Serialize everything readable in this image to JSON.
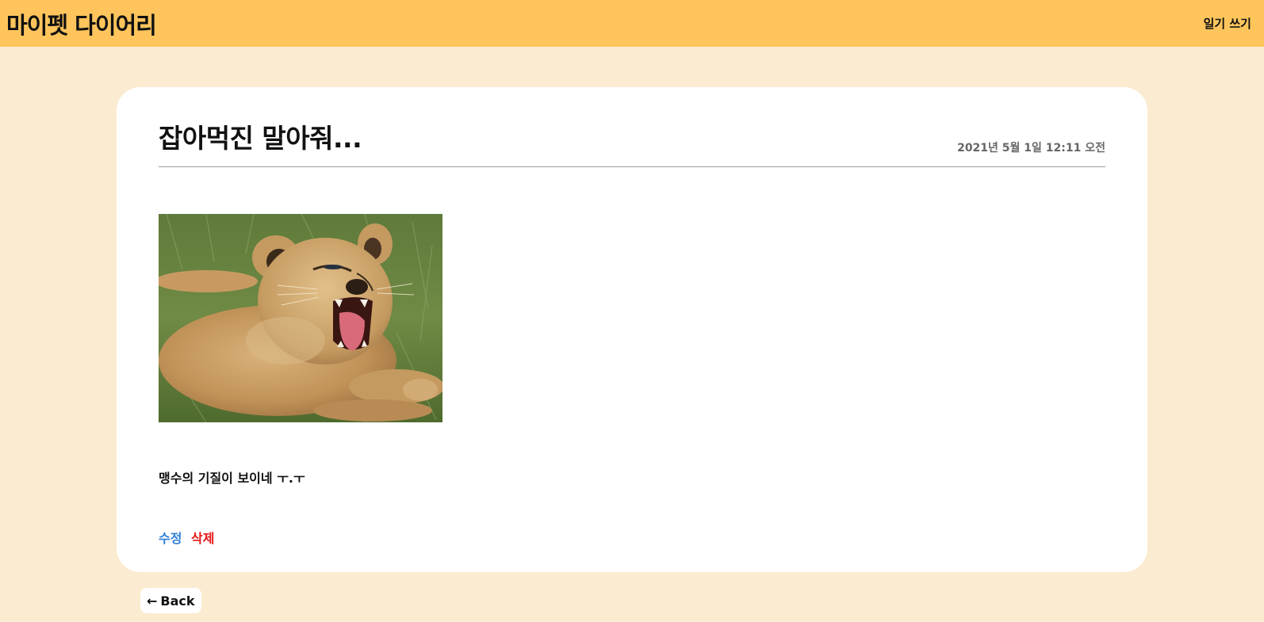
{
  "header": {
    "brand": "마이펫 다이어리",
    "write_link": "일기 쓰기"
  },
  "post": {
    "title": "잡아먹진 말아줘...",
    "date": "2021년 5월 1일 12:11 오전",
    "photo_alt": "lion cub yawning",
    "body": "맹수의 기질이 보이네 ㅜ.ㅜ",
    "edit_label": "수정",
    "delete_label": "삭제"
  },
  "back_button": {
    "arrow": "←",
    "label": "Back"
  },
  "colors": {
    "page_bg": "#fbebd0",
    "topbar_bg": "#ffc55c",
    "card_bg": "#ffffff",
    "edit": "#2f7fd6",
    "delete": "#e61515",
    "date": "#666666"
  }
}
